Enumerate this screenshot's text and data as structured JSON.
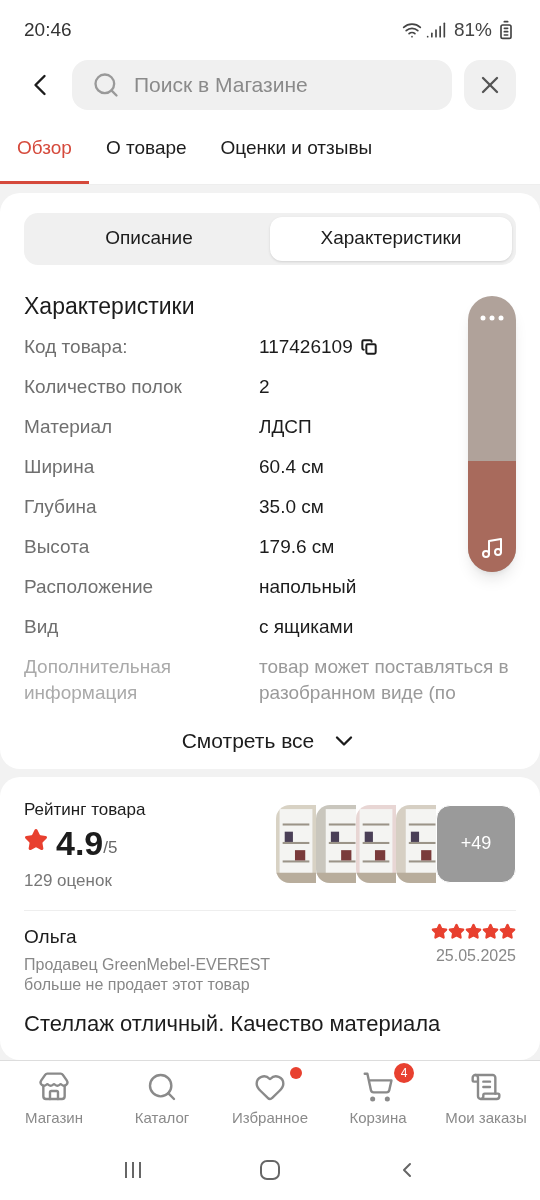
{
  "status_bar": {
    "time": "20:46",
    "battery": "81%"
  },
  "search": {
    "placeholder": "Поиск в Магазине"
  },
  "tabs": [
    {
      "label": "Обзор",
      "selected": true
    },
    {
      "label": "О товаре",
      "selected": false
    },
    {
      "label": "Оценки и отзывы",
      "selected": false
    }
  ],
  "segments": [
    {
      "label": "Описание",
      "selected": false
    },
    {
      "label": "Характеристики",
      "selected": true
    }
  ],
  "specs": {
    "title": "Характеристики",
    "rows": [
      {
        "label": "Код товара:",
        "value": "117426109",
        "copyable": true,
        "faded": false
      },
      {
        "label": "Количество полок",
        "value": "2",
        "copyable": false,
        "faded": false
      },
      {
        "label": "Материал",
        "value": "ЛДСП",
        "copyable": false,
        "faded": false
      },
      {
        "label": "Ширина",
        "value": "60.4 см",
        "copyable": false,
        "faded": false
      },
      {
        "label": "Глубина",
        "value": "35.0 см",
        "copyable": false,
        "faded": false
      },
      {
        "label": "Высота",
        "value": "179.6 см",
        "copyable": false,
        "faded": false
      },
      {
        "label": "Расположение",
        "value": "напольный",
        "copyable": false,
        "faded": false
      },
      {
        "label": "Вид",
        "value": "с ящиками",
        "copyable": false,
        "faded": false
      },
      {
        "label": "Дополнительная информация",
        "value": "товар может поставляться в разобранном виде (по",
        "copyable": false,
        "faded": true
      }
    ],
    "show_all": "Смотреть все"
  },
  "volume_widget": {
    "level": 0.4
  },
  "rating": {
    "title": "Рейтинг товара",
    "score": "4.9",
    "scale": "/5",
    "count": "129 оценок",
    "more_photos": "+49"
  },
  "review": {
    "author": "Ольга",
    "stars": 5,
    "date": "25.05.2025",
    "note": "Продавец GreenMebel-EVEREST больше не продает этот товар",
    "text": "Стеллаж отличный. Качество материала"
  },
  "bottom_nav": [
    {
      "label": "Магазин",
      "kind": "shop",
      "dot": false
    },
    {
      "label": "Каталог",
      "kind": "catalog",
      "dot": false
    },
    {
      "label": "Избранное",
      "kind": "heart",
      "dot": true
    },
    {
      "label": "Корзина",
      "kind": "cart",
      "dot": false,
      "badge": "4"
    },
    {
      "label": "Мои заказы",
      "kind": "orders",
      "dot": false
    }
  ]
}
